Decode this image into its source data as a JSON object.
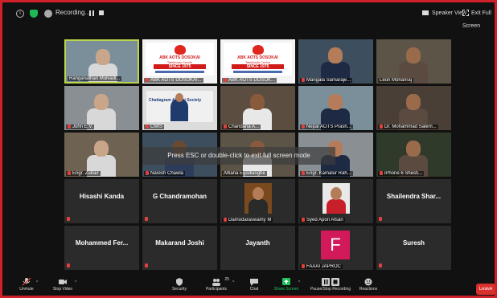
{
  "topbar": {
    "recording_label": "Recording...",
    "speaker_view": "Speaker View",
    "exit_full_screen": "Exit Full Screen"
  },
  "overlay": {
    "esc_message": "Press ESC or double-click to exit full screen mode"
  },
  "tiles": [
    {
      "name": "Ranganathan Mulvadi...",
      "kind": "video",
      "active": true,
      "muted": false
    },
    {
      "name": "ABK AOTS DOSOKAI...",
      "kind": "banner",
      "muted": true,
      "banner": {
        "line1": "ABK AOTS DOSOKAI",
        "line2": "Tamilnadu Centre",
        "line3": "SINCE 1975"
      }
    },
    {
      "name": "ABK AOTS DOSOK...",
      "kind": "banner",
      "muted": true,
      "banner": {
        "line1": "ABK AOTS DOSOKAI",
        "line2": "Tamilnadu Centre",
        "line3": "SINCE 1975"
      }
    },
    {
      "name": "Mangala Samaraje...",
      "kind": "video",
      "muted": true
    },
    {
      "name": "Leon Mohanraj",
      "kind": "video",
      "muted": false
    },
    {
      "name": "John E.V.",
      "kind": "video",
      "muted": true
    },
    {
      "name": "CMIS",
      "kind": "ctg",
      "muted": true,
      "ctg_title": "Chattagram Alumni Society"
    },
    {
      "name": "Chandana A...",
      "kind": "video",
      "muted": true
    },
    {
      "name": "Nepal AOTS Prash...",
      "kind": "video",
      "muted": true
    },
    {
      "name": "Dr. Mohammad Salem...",
      "kind": "video",
      "muted": true
    },
    {
      "name": "Engr. Zubair",
      "kind": "video",
      "muted": true
    },
    {
      "name": "Naresh Chawla",
      "kind": "video",
      "muted": true
    },
    {
      "name": "Alfiana Egodsinghe",
      "kind": "video",
      "muted": false
    },
    {
      "name": "Engr. Kamalur Rah...",
      "kind": "video",
      "muted": true
    },
    {
      "name": "iPhone 6 Shesti...",
      "kind": "video",
      "muted": true
    },
    {
      "name": "",
      "kind": "text",
      "label": "Hisashi Kanda",
      "muted": true
    },
    {
      "name": "",
      "kind": "text",
      "label": "G Chandramohan",
      "muted": true
    },
    {
      "name": "Damodaraswamy M",
      "kind": "photo",
      "muted": true
    },
    {
      "name": "Syed Apon Afsan",
      "kind": "photo",
      "muted": true
    },
    {
      "name": "",
      "kind": "text",
      "label": "Shailendra Shar...",
      "muted": true
    },
    {
      "name": "",
      "kind": "text",
      "label": "Mohammed Fer...",
      "muted": true
    },
    {
      "name": "",
      "kind": "text",
      "label": "Makarand Joshi",
      "muted": true
    },
    {
      "name": "",
      "kind": "text",
      "label": "Jayanth",
      "muted": false
    },
    {
      "name": "FAAAI JAPROC",
      "kind": "avatar",
      "avatar_letter": "F",
      "muted": true
    },
    {
      "name": "",
      "kind": "text",
      "label": "Suresh",
      "muted": true
    }
  ],
  "toolbar": {
    "unmute": "Unmute",
    "stop_video": "Stop Video",
    "security": "Security",
    "participants": "Participants",
    "participants_count": "25",
    "chat": "Chat",
    "share_screen": "Share Screen",
    "pause_recording": "Pause/Stop Recording",
    "reactions": "Reactions",
    "leave": "Leave"
  },
  "colors": {
    "accent_green": "#20c15a",
    "leave_red": "#d8312c",
    "active_border": "#b9d64a",
    "frame_red": "#d0202a"
  }
}
